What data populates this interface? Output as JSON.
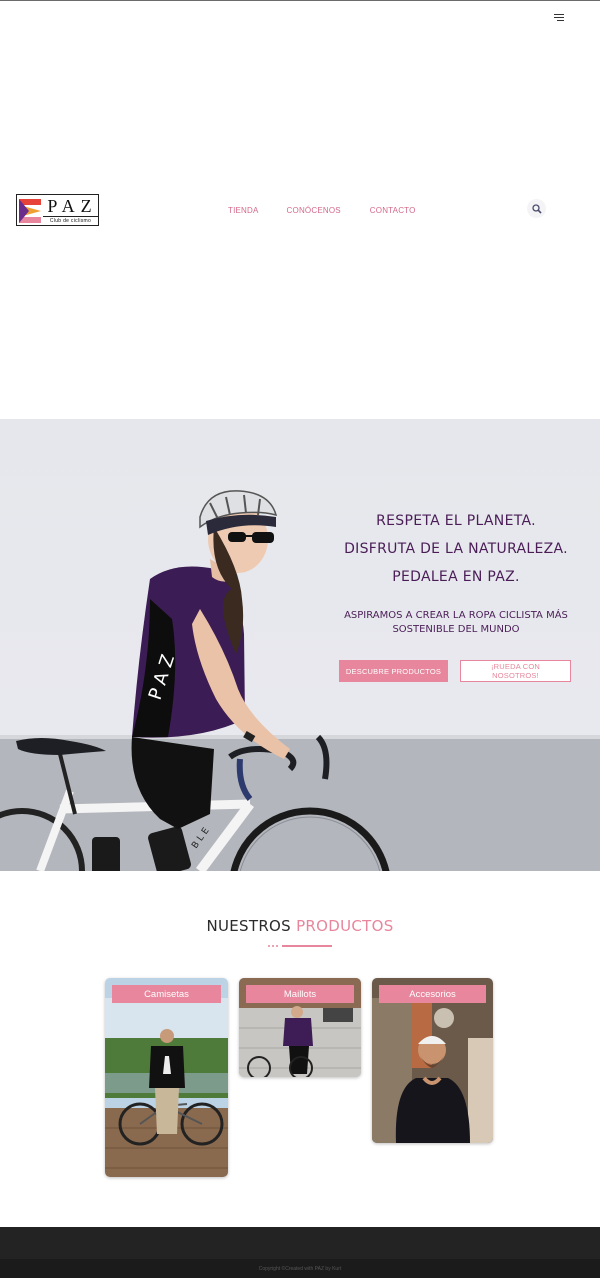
{
  "header": {
    "logo": {
      "word": "PAZ",
      "subtitle": "Club de ciclismo"
    },
    "nav": [
      {
        "label": "TIENDA"
      },
      {
        "label": "CONÓCENOS"
      },
      {
        "label": "CONTACTO"
      }
    ],
    "icons": {
      "menu": "hamburger-icon",
      "search": "search-icon"
    }
  },
  "hero": {
    "title_lines": [
      "RESPETA EL PLANETA.",
      "DISFRUTA DE LA NATURALEZA.",
      "PEDALEA EN PAZ."
    ],
    "subtitle": "ASPIRAMOS A CREAR LA ROPA CICLISTA MÁS SOSTENIBLE DEL MUNDO",
    "primary_button": "DESCUBRE PRODUCTOS",
    "secondary_button": "¡RUEDA CON NOSOTROS!",
    "jersey_text": "PAZ"
  },
  "products": {
    "title_part1": "NUESTROS",
    "title_part2": "PRODUCTOS",
    "items": [
      {
        "label": "Camisetas"
      },
      {
        "label": "Maillots"
      },
      {
        "label": "Accesorios"
      }
    ]
  },
  "footer": {
    "copyright": "Copyright ©Created with PAZ by Kurt"
  },
  "colors": {
    "accent": "#e7869c",
    "headline": "#4a1d57",
    "footer": "#232323"
  }
}
